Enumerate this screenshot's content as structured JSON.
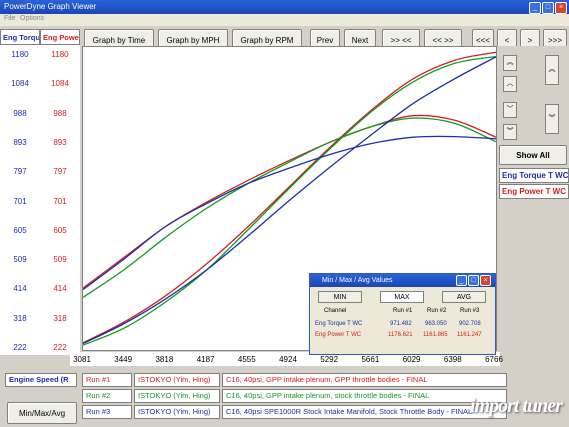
{
  "window": {
    "title": "PowerDyne Graph Viewer"
  },
  "menu": [
    "File",
    "Options"
  ],
  "toolbar": {
    "by_time": "Graph by Time",
    "by_mph": "Graph by MPH",
    "by_rpm": "Graph by RPM",
    "prev": "Prev",
    "next": "Next",
    "zoom1": ">> <<",
    "zoom2": "<< >>",
    "nav1": "<<<",
    "nav2": "<",
    "nav3": ">",
    "nav4": ">>>"
  },
  "left_axis": {
    "torque_header": "Eng Torque",
    "power_header": "Eng Power",
    "torque_ticks": [
      "1180",
      "1084",
      "988",
      "893",
      "797",
      "701",
      "605",
      "509",
      "414",
      "318",
      "222"
    ],
    "power_ticks": [
      "1180",
      "1084",
      "988",
      "893",
      "797",
      "701",
      "605",
      "509",
      "414",
      "318",
      "222"
    ],
    "torque_color": "#1c2fa8",
    "power_color": "#d02020"
  },
  "right_panel": {
    "show_all": "Show All",
    "legend_torque": "Eng Torque T WC",
    "legend_power": "Eng Power T WC"
  },
  "x_axis": {
    "ticks": [
      "3081",
      "3449",
      "3818",
      "4187",
      "4555",
      "4924",
      "5292",
      "5661",
      "6029",
      "6398",
      "6766"
    ]
  },
  "bottom": {
    "engine_speed": "Engine Speed (R",
    "minmax_button": "Min/Max/Avg",
    "runs": [
      {
        "run": "Run #1",
        "driver": "ISTOKYO (Yim, Hing)",
        "desc": "C16, 40psi, GPP intake plenum, GPP throttle bodies - FINAL",
        "color": "#d02020"
      },
      {
        "run": "Run #2",
        "driver": "ISTOKYO (Yim, Hing)",
        "desc": "C16, 40psi, GPP intake plenum, stock throttle bodies - FINAL",
        "color": "#109a20"
      },
      {
        "run": "Run #3",
        "driver": "ISTOKYO (Yim, Hing)",
        "desc": "C16, 40psi SPE1000R Stock Intake Manifold, Stock Throttle Body - FINAL",
        "color": "#1c2fa8"
      }
    ]
  },
  "minmax": {
    "title": "Min / Max / Avg Values",
    "btn_min": "MIN",
    "btn_max": "MAX",
    "btn_avg": "AVG",
    "headers": [
      "Channel",
      "Run #1",
      "Run #2",
      "Run #3"
    ],
    "rows": [
      {
        "channel": "Eng Torque T WC",
        "r1": "971.482",
        "r2": "963.050",
        "r3": "902.708"
      },
      {
        "channel": "Eng Power T WC",
        "r1": "1176.621",
        "r2": "1161.865",
        "r3": "1161.247"
      }
    ]
  },
  "watermark": "import tuner",
  "chart_data": {
    "type": "line",
    "xlabel": "Engine Speed (R",
    "xlim": [
      3081,
      6766
    ],
    "ylim": [
      222,
      1180
    ],
    "series": [
      {
        "name": "Run #1 Eng Torque T WC",
        "color": "#d02020",
        "x": [
          3081,
          3449,
          3818,
          4187,
          4555,
          4924,
          5292,
          5661,
          6029,
          6398,
          6766
        ],
        "y": [
          410,
          510,
          610,
          690,
          760,
          825,
          885,
          935,
          970,
          955,
          900
        ]
      },
      {
        "name": "Run #1 Eng Power T WC",
        "color": "#d02020",
        "x": [
          3081,
          3449,
          3818,
          4187,
          4555,
          4924,
          5292,
          5661,
          6029,
          6398,
          6766
        ],
        "y": [
          232,
          300,
          385,
          490,
          610,
          740,
          870,
          990,
          1090,
          1150,
          1176
        ]
      },
      {
        "name": "Run #2 Eng Torque T WC",
        "color": "#109a20",
        "x": [
          3081,
          3449,
          3818,
          4187,
          4555,
          4924,
          5292,
          5661,
          6029,
          6398,
          6766
        ],
        "y": [
          380,
          470,
          575,
          670,
          750,
          820,
          885,
          935,
          962,
          945,
          885
        ]
      },
      {
        "name": "Run #2 Eng Power T WC",
        "color": "#109a20",
        "x": [
          3081,
          3449,
          3818,
          4187,
          4555,
          4924,
          5292,
          5661,
          6029,
          6398,
          6766
        ],
        "y": [
          225,
          280,
          365,
          470,
          600,
          735,
          865,
          985,
          1080,
          1140,
          1162
        ]
      },
      {
        "name": "Run #3 Eng Torque T WC",
        "color": "#1c2fa8",
        "x": [
          3081,
          3449,
          3818,
          4187,
          4555,
          4924,
          5292,
          5661,
          6029,
          6398,
          6766
        ],
        "y": [
          405,
          505,
          610,
          685,
          750,
          800,
          845,
          880,
          900,
          902,
          895
        ]
      },
      {
        "name": "Run #3 Eng Power T WC",
        "color": "#1c2fa8",
        "x": [
          3081,
          3449,
          3818,
          4187,
          4555,
          4924,
          5292,
          5661,
          6029,
          6398,
          6766
        ],
        "y": [
          230,
          295,
          375,
          470,
          580,
          695,
          805,
          910,
          1010,
          1090,
          1161
        ]
      }
    ]
  }
}
